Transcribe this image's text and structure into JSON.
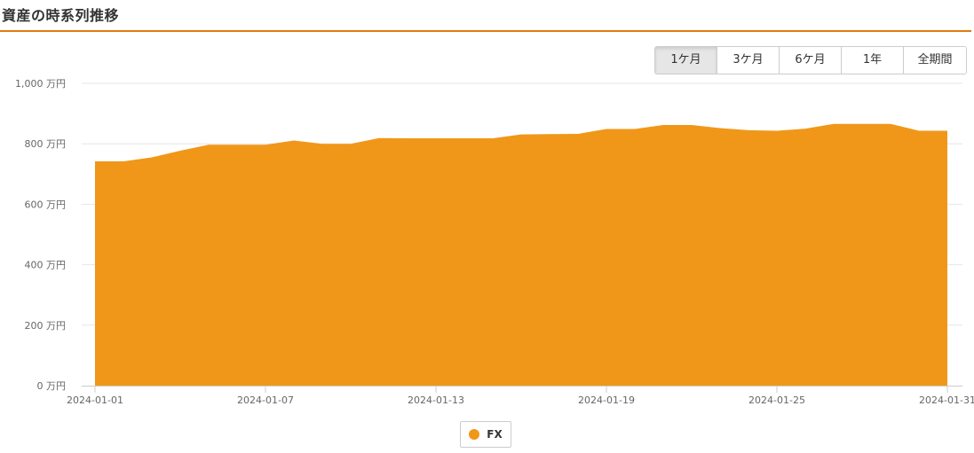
{
  "header": {
    "title": "資産の時系列推移"
  },
  "range_buttons": [
    {
      "label": "1ケ月",
      "active": true
    },
    {
      "label": "3ケ月",
      "active": false
    },
    {
      "label": "6ケ月",
      "active": false
    },
    {
      "label": "1年",
      "active": false
    },
    {
      "label": "全期間",
      "active": false
    }
  ],
  "colors": {
    "accent": "#e07a10",
    "series_fx": "#f09719"
  },
  "chart_data": {
    "type": "area",
    "x": [
      "2024-01-01",
      "2024-01-02",
      "2024-01-03",
      "2024-01-04",
      "2024-01-05",
      "2024-01-06",
      "2024-01-07",
      "2024-01-08",
      "2024-01-09",
      "2024-01-10",
      "2024-01-11",
      "2024-01-12",
      "2024-01-13",
      "2024-01-14",
      "2024-01-15",
      "2024-01-16",
      "2024-01-17",
      "2024-01-18",
      "2024-01-19",
      "2024-01-20",
      "2024-01-21",
      "2024-01-22",
      "2024-01-23",
      "2024-01-24",
      "2024-01-25",
      "2024-01-26",
      "2024-01-27",
      "2024-01-28",
      "2024-01-29",
      "2024-01-30",
      "2024-01-31"
    ],
    "series": [
      {
        "name": "FX",
        "values": [
          742,
          742,
          755,
          777,
          797,
          797,
          797,
          811,
          800,
          800,
          819,
          818,
          818,
          818,
          818,
          831,
          832,
          833,
          849,
          849,
          862,
          862,
          852,
          845,
          843,
          850,
          866,
          866,
          866,
          843,
          843
        ]
      }
    ],
    "ylim": [
      0,
      1000
    ],
    "y_ticks": [
      0,
      200,
      400,
      600,
      800,
      1000
    ],
    "y_tick_labels": [
      "0 万円",
      "200 万円",
      "400 万円",
      "600 万円",
      "800 万円",
      "1,000 万円"
    ],
    "x_tick_labels": [
      "2024-01-01",
      "2024-01-07",
      "2024-01-13",
      "2024-01-19",
      "2024-01-25",
      "2024-01-31"
    ],
    "x_tick_values": [
      "2024-01-01",
      "2024-01-07",
      "2024-01-13",
      "2024-01-19",
      "2024-01-25",
      "2024-01-31"
    ],
    "grid": true,
    "legend": "bottom-center"
  }
}
